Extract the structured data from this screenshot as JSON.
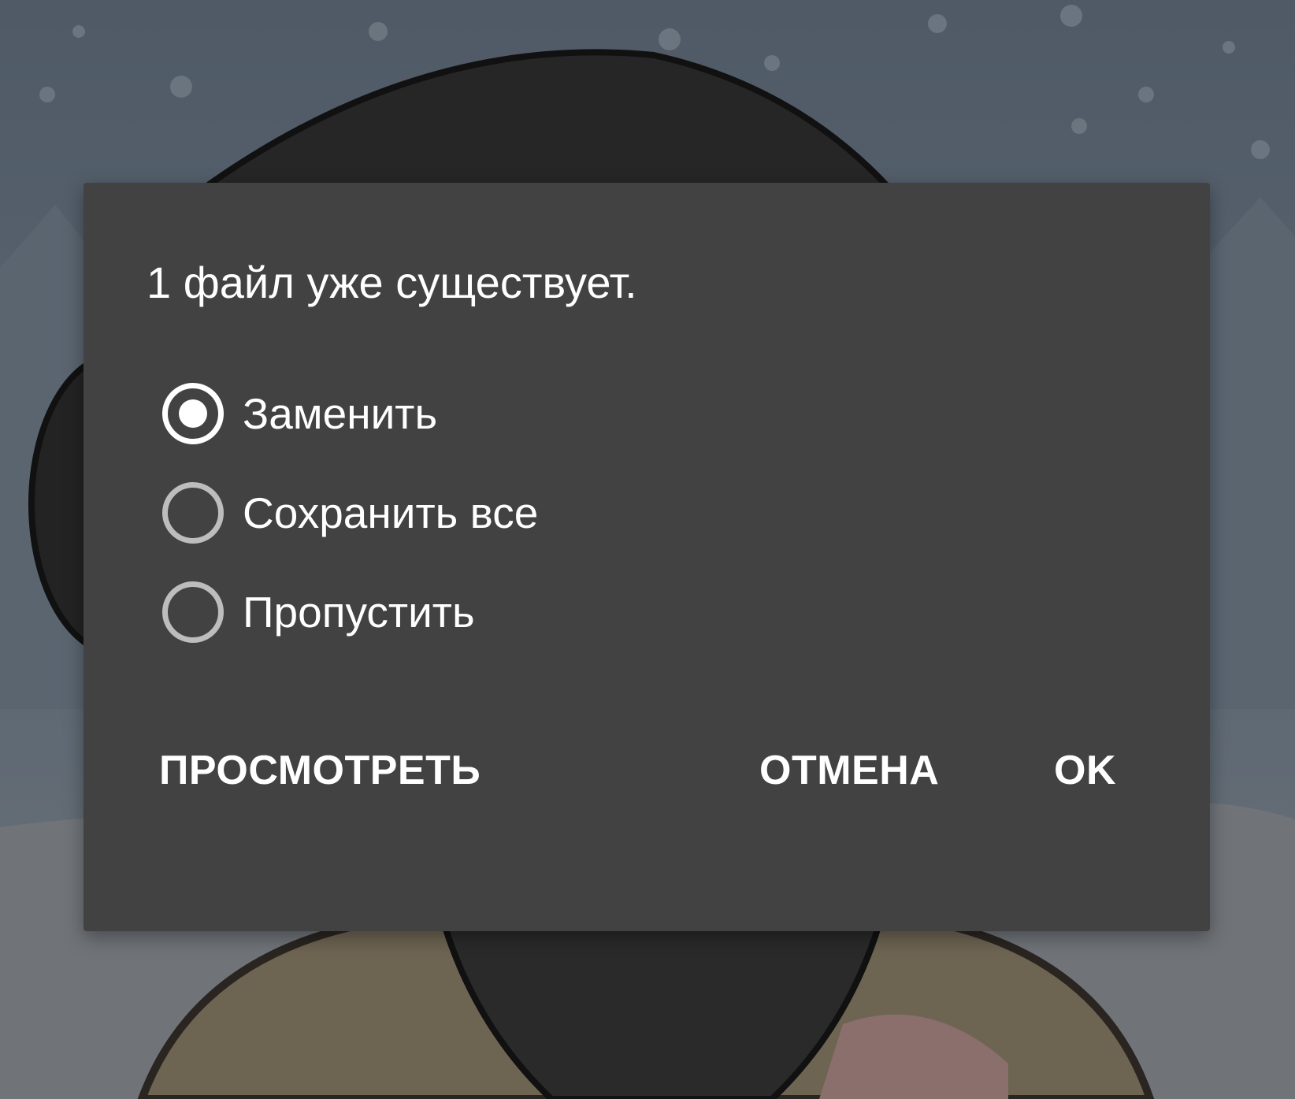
{
  "dialog": {
    "title": "1 файл уже существует.",
    "options": [
      {
        "label": "Заменить",
        "checked": true
      },
      {
        "label": "Сохранить все",
        "checked": false
      },
      {
        "label": "Пропустить",
        "checked": false
      }
    ],
    "buttons": {
      "view": "ПРОСМОТРЕТЬ",
      "cancel": "ОТМЕНА",
      "ok": "OK"
    }
  },
  "colors": {
    "dialog_background": "#424242",
    "text": "#ffffff",
    "radio_unchecked": "#bdbdbd"
  }
}
